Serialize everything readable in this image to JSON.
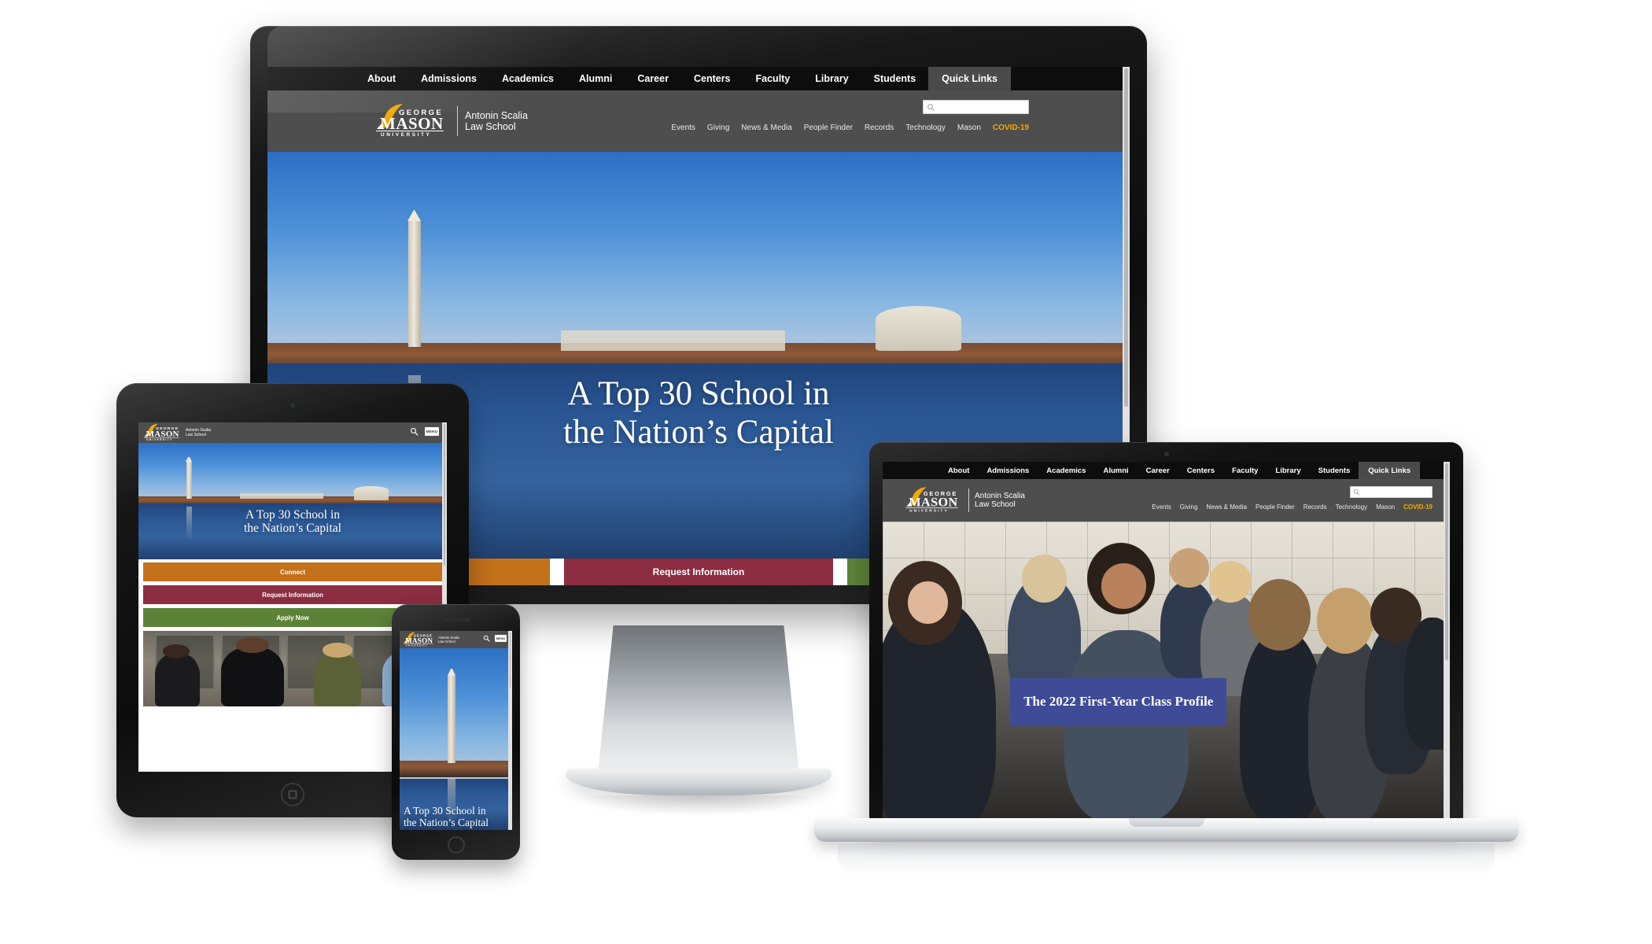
{
  "site": {
    "brand": {
      "logo_line1": "GEORGE",
      "logo_line2": "MASON",
      "logo_line3": "U N I V E R S I T Y",
      "sub_line1": "Antonin Scalia",
      "sub_line2": "Law School",
      "mark_name": "gmu-flame-logo"
    },
    "primary_nav": [
      {
        "label": "About",
        "active": false
      },
      {
        "label": "Admissions",
        "active": false
      },
      {
        "label": "Academics",
        "active": false
      },
      {
        "label": "Alumni",
        "active": false
      },
      {
        "label": "Career",
        "active": false
      },
      {
        "label": "Centers",
        "active": false
      },
      {
        "label": "Faculty",
        "active": false
      },
      {
        "label": "Library",
        "active": false
      },
      {
        "label": "Students",
        "active": false
      },
      {
        "label": "Quick Links",
        "active": true
      }
    ],
    "utility_nav": [
      {
        "label": "Events",
        "highlight": false
      },
      {
        "label": "Giving",
        "highlight": false
      },
      {
        "label": "News & Media",
        "highlight": false
      },
      {
        "label": "People Finder",
        "highlight": false
      },
      {
        "label": "Records",
        "highlight": false
      },
      {
        "label": "Technology",
        "highlight": false
      },
      {
        "label": "Mason",
        "highlight": false
      },
      {
        "label": "COVID-19",
        "highlight": true
      }
    ],
    "search": {
      "placeholder": "",
      "value": "",
      "icon": "search-icon"
    },
    "mobile": {
      "search_icon": "search-icon",
      "menu_label": "MENU"
    },
    "hero": {
      "headline_line1": "A Top 30 School in",
      "headline_line2": "the Nation’s Capital",
      "image_alt": "washington-monument-and-jefferson-memorial-tidal-basin"
    },
    "cta_buttons": [
      {
        "label": "Connect",
        "color": "#c3711a",
        "style": "orange"
      },
      {
        "label": "Request Information",
        "color": "#8c2d42",
        "style": "maroon"
      },
      {
        "label": "Apply Now",
        "color": "#5c8238",
        "style": "green"
      }
    ],
    "laptop_hero": {
      "banner_text": "The 2022 First-Year Class Profile",
      "banner_color": "#3f4b96",
      "image_alt": "law-students-seated-in-classroom"
    },
    "tablet_photo": {
      "image_alt": "students-walking-outside-campus-building"
    },
    "colors": {
      "nav_black": "#0d0d0d",
      "brand_gray": "#4e4e4e",
      "active_tab": "#4a4a4a",
      "gold": "#f2a900",
      "orange": "#c3711a",
      "maroon": "#8c2d42",
      "green": "#5c8238",
      "banner_blue": "#3f4b96"
    }
  },
  "devices": [
    {
      "name": "desktop-monitor",
      "type": "monitor"
    },
    {
      "name": "tablet",
      "type": "tablet"
    },
    {
      "name": "smartphone",
      "type": "phone"
    },
    {
      "name": "laptop",
      "type": "laptop"
    }
  ]
}
